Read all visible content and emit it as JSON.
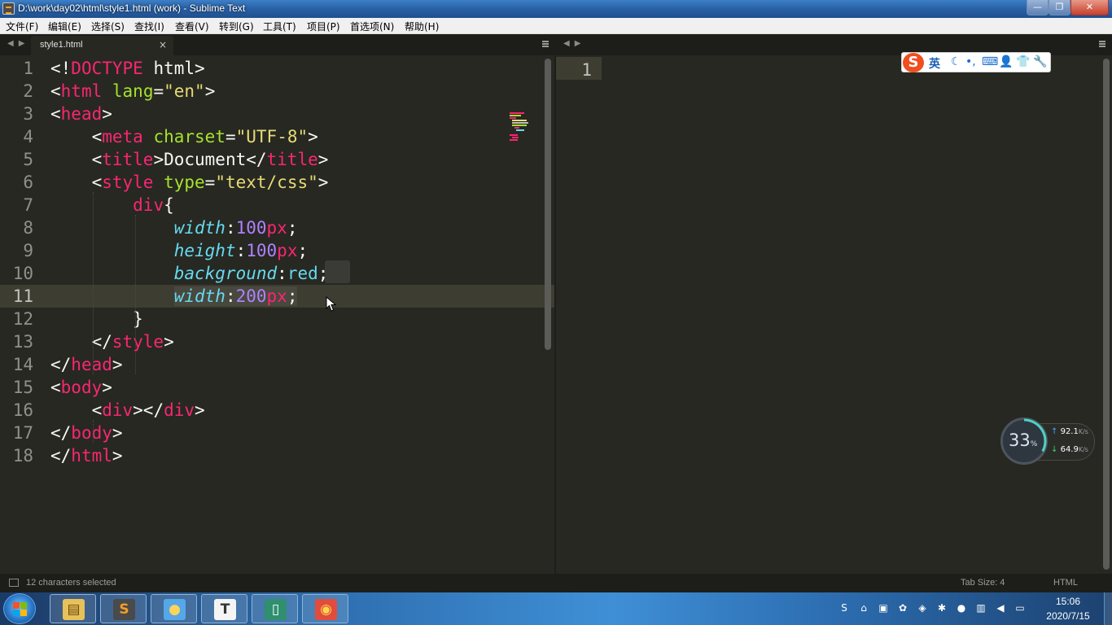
{
  "window": {
    "title": "D:\\work\\day02\\html\\style1.html (work) - Sublime Text",
    "minimize": "—",
    "maximize": "❐",
    "close": "✕"
  },
  "menu": [
    "文件(F)",
    "编辑(E)",
    "选择(S)",
    "查找(I)",
    "查看(V)",
    "转到(G)",
    "工具(T)",
    "项目(P)",
    "首选项(N)",
    "帮助(H)"
  ],
  "tabs": {
    "left": {
      "label": "style1.html",
      "close": "×",
      "nav": "◀▶"
    },
    "right": {
      "nav": "◀▶"
    }
  },
  "editor": {
    "current_line": 11,
    "lines": [
      {
        "n": "1",
        "tokens": [
          [
            "t-plain",
            "<!"
          ],
          [
            "t-tag",
            "DOCTYPE"
          ],
          [
            "t-plain",
            " html>"
          ]
        ]
      },
      {
        "n": "2",
        "tokens": [
          [
            "t-plain",
            "<"
          ],
          [
            "t-tag",
            "html"
          ],
          [
            "t-plain",
            " "
          ],
          [
            "t-attr",
            "lang"
          ],
          [
            "t-plain",
            "="
          ],
          [
            "t-str",
            "\"en\""
          ],
          [
            "t-plain",
            ">"
          ]
        ]
      },
      {
        "n": "3",
        "tokens": [
          [
            "t-plain",
            "<"
          ],
          [
            "t-tag",
            "head"
          ],
          [
            "t-plain",
            ">"
          ]
        ]
      },
      {
        "n": "4",
        "tokens": [
          [
            "t-plain",
            "    <"
          ],
          [
            "t-tag",
            "meta"
          ],
          [
            "t-plain",
            " "
          ],
          [
            "t-attr",
            "charset"
          ],
          [
            "t-plain",
            "="
          ],
          [
            "t-str",
            "\"UTF-8\""
          ],
          [
            "t-plain",
            ">"
          ]
        ]
      },
      {
        "n": "5",
        "tokens": [
          [
            "t-plain",
            "    <"
          ],
          [
            "t-tag",
            "title"
          ],
          [
            "t-plain",
            ">Document</"
          ],
          [
            "t-tag",
            "title"
          ],
          [
            "t-plain",
            ">"
          ]
        ]
      },
      {
        "n": "6",
        "tokens": [
          [
            "t-plain",
            "    <"
          ],
          [
            "t-tag",
            "style"
          ],
          [
            "t-plain",
            " "
          ],
          [
            "t-attr",
            "type"
          ],
          [
            "t-plain",
            "="
          ],
          [
            "t-str",
            "\"text/css\""
          ],
          [
            "t-plain",
            ">"
          ]
        ]
      },
      {
        "n": "7",
        "tokens": [
          [
            "t-plain",
            "        "
          ],
          [
            "t-tag",
            "div"
          ],
          [
            "t-plain",
            "{"
          ]
        ]
      },
      {
        "n": "8",
        "tokens": [
          [
            "t-plain",
            "            "
          ],
          [
            "t-prop",
            "width"
          ],
          [
            "t-plain",
            ":"
          ],
          [
            "t-num",
            "100"
          ],
          [
            "t-unit",
            "px"
          ],
          [
            "t-plain",
            ";"
          ]
        ]
      },
      {
        "n": "9",
        "tokens": [
          [
            "t-plain",
            "            "
          ],
          [
            "t-prop",
            "height"
          ],
          [
            "t-plain",
            ":"
          ],
          [
            "t-num",
            "100"
          ],
          [
            "t-unit",
            "px"
          ],
          [
            "t-plain",
            ";"
          ]
        ]
      },
      {
        "n": "10",
        "tokens": [
          [
            "t-plain",
            "            "
          ],
          [
            "t-prop",
            "background"
          ],
          [
            "t-plain",
            ":"
          ],
          [
            "t-val",
            "red"
          ],
          [
            "t-plain",
            ";"
          ]
        ]
      },
      {
        "n": "11",
        "tokens": [
          [
            "t-plain",
            "            "
          ],
          [
            "t-prop sel",
            "width"
          ],
          [
            "t-plain sel",
            ":"
          ],
          [
            "t-num sel",
            "200"
          ],
          [
            "t-unit sel",
            "px"
          ],
          [
            "t-plain sel",
            ";"
          ]
        ]
      },
      {
        "n": "12",
        "tokens": [
          [
            "t-plain",
            "        }"
          ]
        ]
      },
      {
        "n": "13",
        "tokens": [
          [
            "t-plain",
            "    </"
          ],
          [
            "t-tag",
            "style"
          ],
          [
            "t-plain",
            ">"
          ]
        ]
      },
      {
        "n": "14",
        "tokens": [
          [
            "t-plain",
            "</"
          ],
          [
            "t-tag",
            "head"
          ],
          [
            "t-plain",
            ">"
          ]
        ]
      },
      {
        "n": "15",
        "tokens": [
          [
            "t-plain",
            "<"
          ],
          [
            "t-tag",
            "body"
          ],
          [
            "t-plain",
            ">"
          ]
        ]
      },
      {
        "n": "16",
        "tokens": [
          [
            "t-plain",
            "    <"
          ],
          [
            "t-tag",
            "div"
          ],
          [
            "t-plain",
            "></"
          ],
          [
            "t-tag",
            "div"
          ],
          [
            "t-plain",
            ">"
          ]
        ]
      },
      {
        "n": "17",
        "tokens": [
          [
            "t-plain",
            "</"
          ],
          [
            "t-tag",
            "body"
          ],
          [
            "t-plain",
            ">"
          ]
        ]
      },
      {
        "n": "18",
        "tokens": [
          [
            "t-plain",
            "</"
          ],
          [
            "t-tag",
            "html"
          ],
          [
            "t-plain",
            ">"
          ]
        ]
      }
    ],
    "right_line_number": "1"
  },
  "ime": {
    "logo": "S",
    "lang": "英",
    "icons": [
      "☾",
      "•,",
      "⌨",
      "👤",
      "👕",
      "🔧"
    ]
  },
  "network": {
    "cpu": "33",
    "cpu_unit": "%",
    "up": "92.1",
    "down": "64.9",
    "unit": "K/s",
    "up_arrow": "↑",
    "down_arrow": "↓"
  },
  "status": {
    "selection": "12 characters selected",
    "tab_size": "Tab Size: 4",
    "syntax": "HTML"
  },
  "taskbar": {
    "apps": [
      {
        "name": "explorer",
        "glyph": "▤",
        "bg": "#e8c15a",
        "fg": "#6a4a10"
      },
      {
        "name": "sublime",
        "glyph": "S",
        "bg": "#4a4a4a",
        "fg": "#f29e2a"
      },
      {
        "name": "chat",
        "glyph": "●",
        "bg": "#56a7e8",
        "fg": "#fbd45a"
      },
      {
        "name": "typora",
        "glyph": "T",
        "bg": "#f4f4f4",
        "fg": "#333333"
      },
      {
        "name": "notepad",
        "glyph": "▯",
        "bg": "#2f8f6f",
        "fg": "#ffffff"
      },
      {
        "name": "chrome",
        "glyph": "◉",
        "bg": "#e24c3c",
        "fg": "#fbd64c"
      }
    ],
    "tray_icons": [
      "S",
      "⌂",
      "▣",
      "✿",
      "◈",
      "✱",
      "●",
      "▥",
      "◀",
      "▭"
    ],
    "time": "15:06",
    "date": "2020/7/15"
  }
}
